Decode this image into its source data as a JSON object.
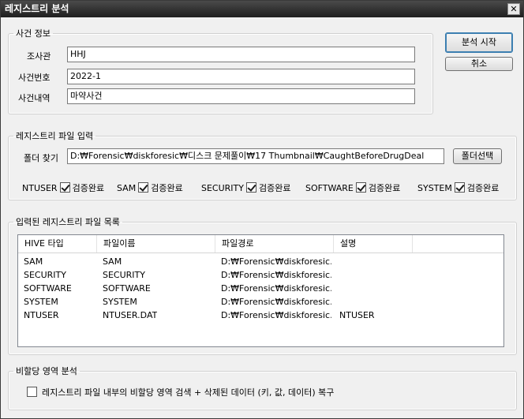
{
  "window": {
    "title": "레지스트리 분석",
    "close_glyph": "✕"
  },
  "case_info": {
    "legend": "사건 정보",
    "investigator_label": "조사관",
    "investigator_value": "HHJ",
    "case_number_label": "사건번호",
    "case_number_value": "2022-1",
    "case_desc_label": "사건내역",
    "case_desc_value": "마약사건"
  },
  "buttons": {
    "start": "분석 시작",
    "cancel": "취소",
    "select_folder": "폴더선택"
  },
  "file_input": {
    "legend": "레지스트리 파일 입력",
    "folder_label": "폴더 찾기",
    "folder_path": "D:₩Forensic₩diskforesic₩디스크 문제풀이₩17 Thumbnail₩CaughtBeforeDrugDeal",
    "verify_label": "검증완료",
    "hives": [
      {
        "name": "NTUSER",
        "checked": true
      },
      {
        "name": "SAM",
        "checked": true
      },
      {
        "name": "SECURITY",
        "checked": true
      },
      {
        "name": "SOFTWARE",
        "checked": true
      },
      {
        "name": "SYSTEM",
        "checked": true
      }
    ]
  },
  "file_list": {
    "legend": "입력된 레지스트리 파일 목록",
    "columns": [
      "HIVE 타입",
      "파일이름",
      "파일경로",
      "설명"
    ],
    "rows": [
      [
        "SAM",
        "SAM",
        "D:₩Forensic₩diskforesic...",
        ""
      ],
      [
        "SECURITY",
        "SECURITY",
        "D:₩Forensic₩diskforesic...",
        ""
      ],
      [
        "SOFTWARE",
        "SOFTWARE",
        "D:₩Forensic₩diskforesic...",
        ""
      ],
      [
        "SYSTEM",
        "SYSTEM",
        "D:₩Forensic₩diskforesic...",
        ""
      ],
      [
        "NTUSER",
        "NTUSER.DAT",
        "D:₩Forensic₩diskforesic...",
        "NTUSER"
      ]
    ]
  },
  "unallocated": {
    "legend": "비할당 영역 분석",
    "option_label": "레지스트리 파일 내부의 비할당 영역 검색 + 삭제된 데이터 (키, 값, 데이터) 복구",
    "checked": false
  }
}
